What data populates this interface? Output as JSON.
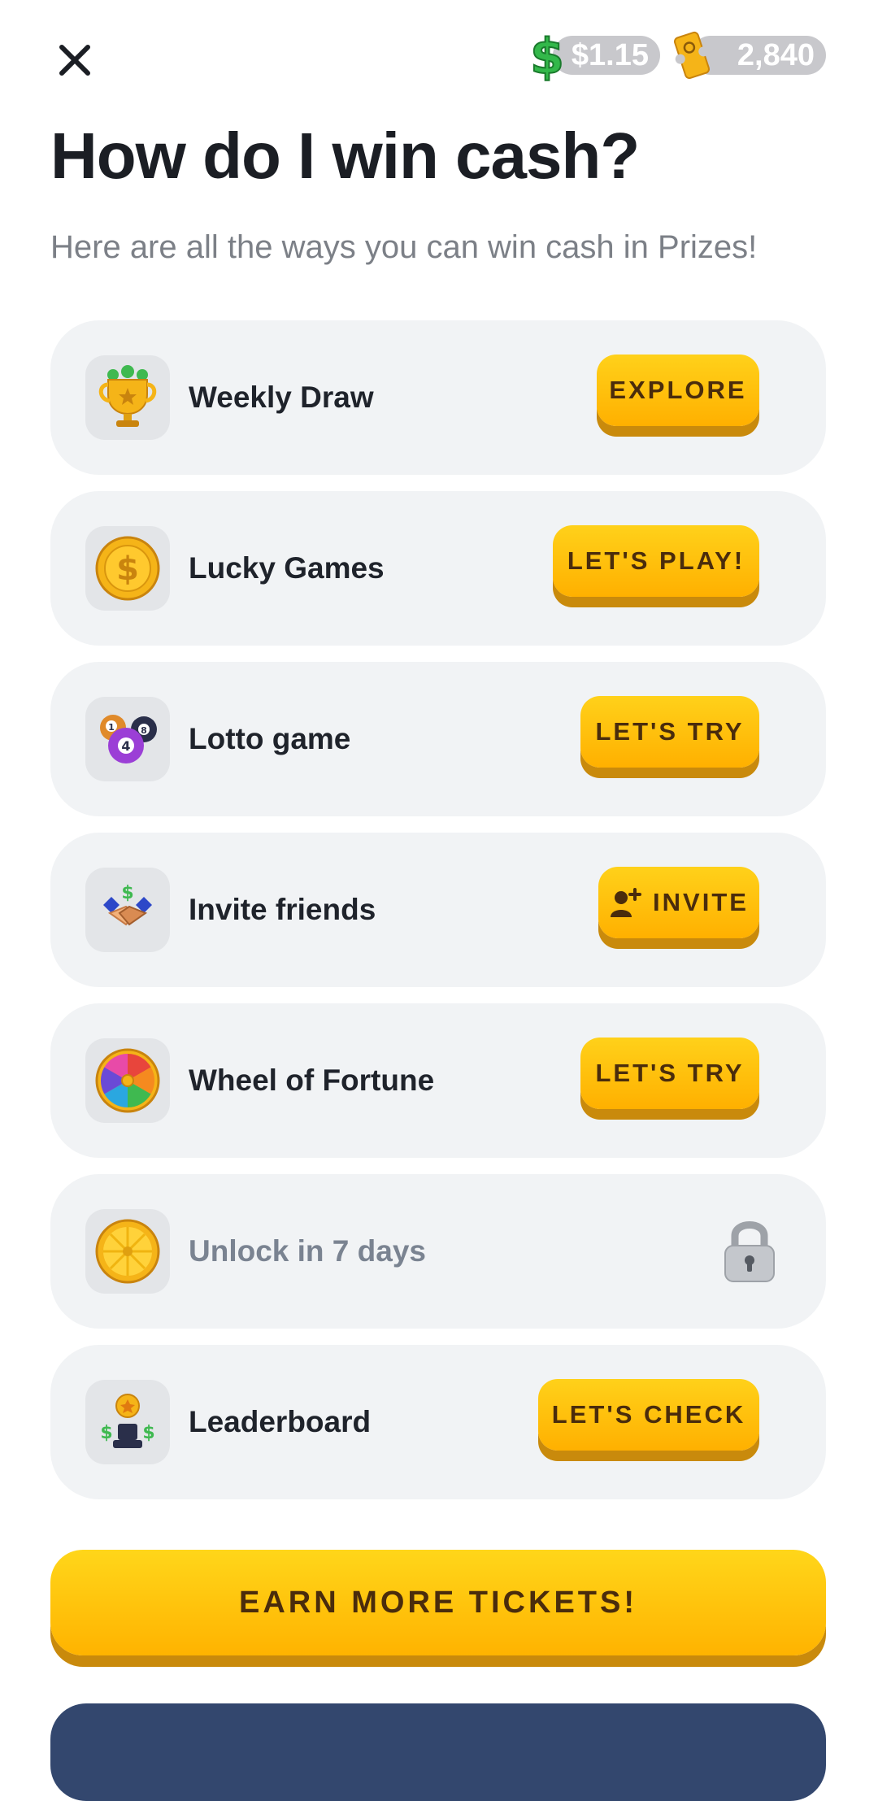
{
  "header": {
    "cash_balance": "$1.15",
    "ticket_balance": "2,840",
    "cash_icon": "dollar-sign-icon",
    "ticket_icon": "ticket-icon",
    "close_icon": "close-icon"
  },
  "page": {
    "title": "How do I win cash?",
    "subtitle": "Here are all the ways you can win cash in Prizes!"
  },
  "ways": [
    {
      "label": "Weekly Draw",
      "button": "EXPLORE",
      "icon": "trophy-icon"
    },
    {
      "label": "Lucky Games",
      "button": "LET'S PLAY!",
      "icon": "coin-icon"
    },
    {
      "label": "Lotto game",
      "button": "LET'S TRY",
      "icon": "lotto-balls-icon"
    },
    {
      "label": "Invite friends",
      "button": "INVITE",
      "icon": "handshake-icon",
      "button_icon": "add-person-icon"
    },
    {
      "label": "Wheel of Fortune",
      "button": "LET'S TRY",
      "icon": "fortune-wheel-icon"
    },
    {
      "label": "Unlock in 7 days",
      "locked": true,
      "icon": "gold-wheel-icon",
      "status_icon": "lock-icon"
    },
    {
      "label": "Leaderboard",
      "button": "LET'S CHECK",
      "icon": "podium-icon"
    }
  ],
  "cta": {
    "label": "EARN MORE TICKETS!"
  },
  "colors": {
    "accent": "#ffc107",
    "button_shadow": "#c98a0c",
    "button_text": "#4a2c0c",
    "card_bg": "#f1f3f5",
    "bottom_bar": "#33476e"
  }
}
